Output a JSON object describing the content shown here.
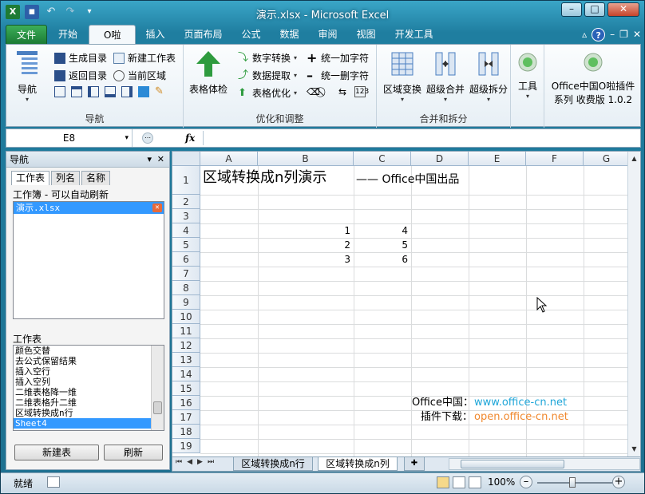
{
  "window": {
    "title": "演示.xlsx - Microsoft Excel"
  },
  "tabs": [
    {
      "label": "文件"
    },
    {
      "label": "开始"
    },
    {
      "label": "O啦"
    },
    {
      "label": "插入"
    },
    {
      "label": "页面布局"
    },
    {
      "label": "公式"
    },
    {
      "label": "数据"
    },
    {
      "label": "审阅"
    },
    {
      "label": "视图"
    },
    {
      "label": "开发工具"
    }
  ],
  "ribbon": {
    "nav_group": {
      "label": "导航",
      "nav_button": "导航",
      "gen_catalog": "生成目录",
      "new_sheet": "新建工作表",
      "return_catalog": "返回目录",
      "current_region": "当前区域"
    },
    "opt_group": {
      "label": "优化和调整",
      "table_check": "表格体检",
      "num_convert": "数字转换",
      "data_extract": "数据提取",
      "table_optimize": "表格优化",
      "unify_add": "统一加字符",
      "unify_delete": "统一删字符"
    },
    "merge_group": {
      "label": "合并和拆分",
      "region_transform": "区域变换",
      "super_merge": "超级合并",
      "super_split": "超级拆分"
    },
    "tools": {
      "label": "工具"
    },
    "plugin": {
      "line1": "Office中国O啦插件",
      "line2": "系列 收费版 1.0.2"
    }
  },
  "formula_bar": {
    "name_box": "E8",
    "fx": "fx",
    "formula": ""
  },
  "nav_pane": {
    "title": "导航",
    "tabs": [
      "工作表",
      "列名",
      "名称"
    ],
    "workbook_hint": "工作簿 - 可以自动刷新",
    "workbooks": [
      "演示.xlsx"
    ],
    "sheets_label": "工作表",
    "sheets": [
      "颜色交替",
      "去公式保留结果",
      "插入空行",
      "插入空列",
      "二维表格降一维",
      "二维表格升二维",
      "区域转换成n行",
      "Sheet4"
    ],
    "selected_sheet": "Sheet4",
    "new_sheet_btn": "新建表",
    "refresh_btn": "刷新"
  },
  "sheet": {
    "columns": [
      "A",
      "B",
      "C",
      "D",
      "E",
      "F",
      "G"
    ],
    "rows": [
      "1",
      "2",
      "3",
      "4",
      "5",
      "6",
      "7",
      "8",
      "9",
      "10",
      "11",
      "12",
      "13",
      "14",
      "15",
      "16",
      "17",
      "18",
      "19"
    ],
    "title": "区域转换成n列演示",
    "subtitle": "—— Office中国出品",
    "b4": "1",
    "c4": "4",
    "b5": "2",
    "c5": "5",
    "b6": "3",
    "c6": "6",
    "office_label": "Office中国：",
    "office_url": "www.office-cn.net",
    "plugin_label": "插件下载：",
    "plugin_url": "open.office-cn.net",
    "link_color": "#1fa6d8",
    "orange_color": "#f0882e"
  },
  "sheet_tabs": [
    "区域转换成n行",
    "区域转换成n列"
  ],
  "active_sheet_tab": "区域转换成n列",
  "status": {
    "ready": "就绪",
    "zoom": "100%"
  }
}
